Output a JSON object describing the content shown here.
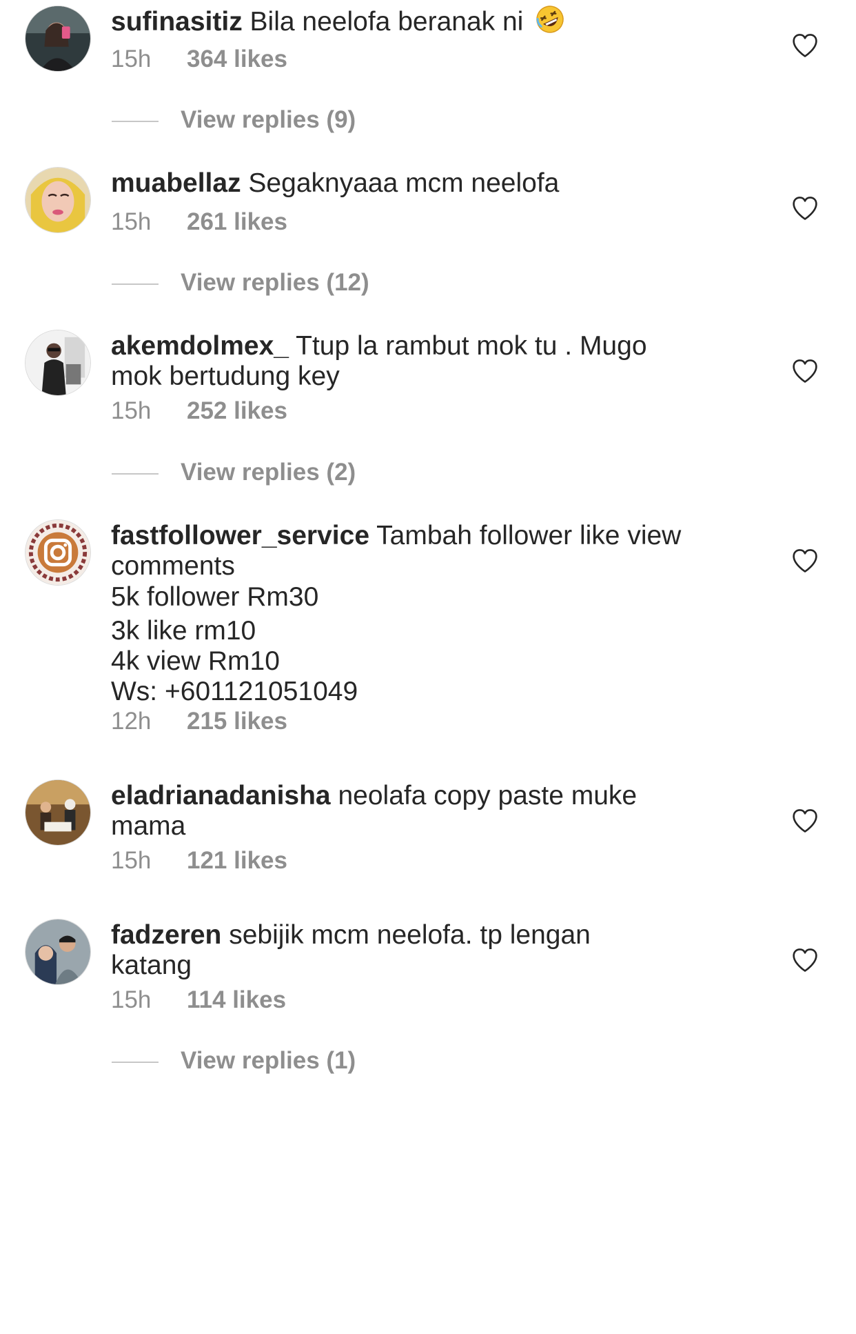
{
  "comments": [
    {
      "username": "sufinasitiz",
      "text": "Bila neelofa beranak ni",
      "emoji": "rolling-on-floor-laughing",
      "time": "15h",
      "likes": "364 likes",
      "view_replies": "View replies (9)"
    },
    {
      "username": "muabellaz",
      "text": "Segaknyaaa mcm neelofa",
      "time": "15h",
      "likes": "261 likes",
      "view_replies": "View replies (12)"
    },
    {
      "username": "akemdolmex_",
      "text": "Ttup la rambut mok tu . Mugo",
      "text_line2": "mok bertudung key",
      "time": "15h",
      "likes": "252 likes",
      "view_replies": "View replies (2)"
    },
    {
      "username": "fastfollower_service",
      "text": "Tambah follower like view",
      "text_line2": "comments",
      "lines": [
        "5k follower Rm30",
        "3k like rm10",
        "4k view Rm10",
        "Ws: +601121051049"
      ],
      "time": "12h",
      "likes": "215 likes"
    },
    {
      "username": "eladrianadanisha",
      "text": "neolafa copy paste muke",
      "text_line2": "mama",
      "time": "15h",
      "likes": "121 likes"
    },
    {
      "username": "fadzeren",
      "text": "sebijik mcm neelofa. tp lengan",
      "text_line2": "katang",
      "time": "15h",
      "likes": "114 likes",
      "view_replies": "View replies (1)"
    }
  ],
  "colors": {
    "text": "#262626",
    "secondary": "#8e8e8e",
    "divider": "#c7c7c7"
  }
}
